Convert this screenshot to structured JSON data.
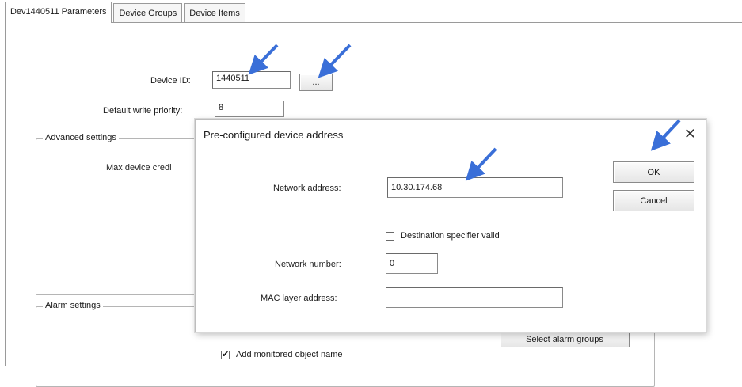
{
  "tabs": [
    {
      "label": "Dev1440511 Parameters",
      "active": true
    },
    {
      "label": "Device Groups",
      "active": false
    },
    {
      "label": "Device Items",
      "active": false
    }
  ],
  "main": {
    "device_id_label": "Device ID:",
    "device_id_value": "1440511",
    "browse_button_label": "...",
    "write_priority_label": "Default write priority:",
    "write_priority_value": "8",
    "advanced_group_title": "Advanced settings",
    "max_device_label": "Max device credi",
    "alarm_group_title": "Alarm settings",
    "alarm_groups_button_label": "Select alarm groups",
    "add_monitored_label": "Add monitored object name",
    "add_monitored_checked": true
  },
  "dialog": {
    "title": "Pre-configured device address",
    "close_icon": "close-icon",
    "network_address_label": "Network address:",
    "network_address_value": "10.30.174.68",
    "destination_label": "Destination specifier valid",
    "destination_checked": false,
    "network_number_label": "Network number:",
    "network_number_value": "0",
    "mac_label": "MAC layer address:",
    "mac_value": "",
    "ok_label": "OK",
    "cancel_label": "Cancel"
  },
  "annotation_color": "#3a6fd8"
}
